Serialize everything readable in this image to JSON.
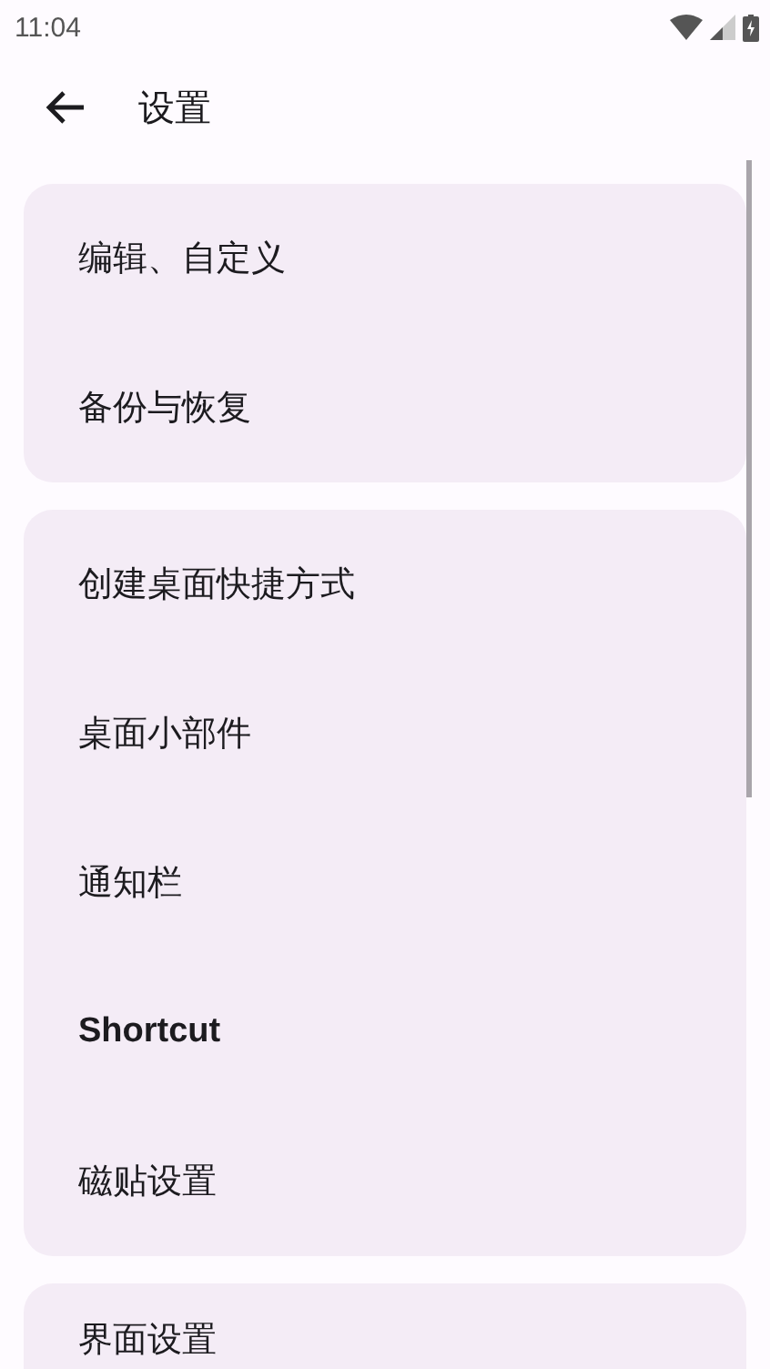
{
  "status_bar": {
    "time": "11:04"
  },
  "toolbar": {
    "title": "设置"
  },
  "groups": [
    {
      "items": [
        {
          "label": "编辑、自定义"
        },
        {
          "label": "备份与恢复"
        }
      ]
    },
    {
      "items": [
        {
          "label": "创建桌面快捷方式"
        },
        {
          "label": "桌面小部件"
        },
        {
          "label": "通知栏"
        },
        {
          "label": "Shortcut"
        },
        {
          "label": "磁贴设置"
        }
      ]
    },
    {
      "items": [
        {
          "label": "界面设置"
        }
      ]
    }
  ]
}
